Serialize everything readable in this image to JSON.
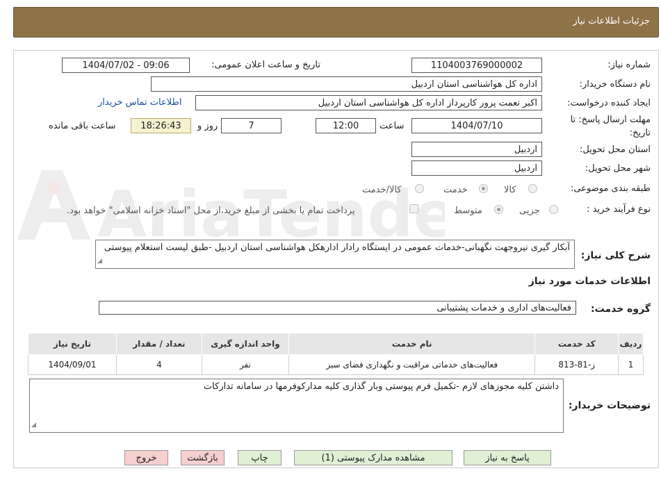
{
  "header": {
    "title": "جزئیات اطلاعات نیاز"
  },
  "watermark": {
    "text": "AriaTender.neT"
  },
  "fields": {
    "need_number_label": "شماره نیاز:",
    "need_number": "1104003769000002",
    "announce_label": "تاریخ و ساعت اعلان عمومی:",
    "announce_value": "1404/07/02 - 09:06",
    "buyer_org_label": "نام دستگاه خریدار:",
    "buyer_org": "اداره کل هواشناسی استان اردبیل",
    "requester_label": "ایجاد کننده درخواست:",
    "requester": "اکبر نعمت پرور کارپرداز اداره کل هواشناسی استان اردبیل",
    "contact_link": "اطلاعات تماس خریدار",
    "deadline_label_1": "مهلت ارسال پاسخ: تا",
    "deadline_label_2": "تاریخ:",
    "deadline_date": "1404/07/10",
    "time_label": "ساعت",
    "deadline_time": "12:00",
    "days_value": "7",
    "days_label": "روز و",
    "remaining_time": "18:26:43",
    "remaining_label": "ساعت باقی مانده",
    "province_label": "استان محل تحویل:",
    "province": "اردبیل",
    "city_label": "شهر محل تحویل:",
    "city": "اردبیل",
    "category_label": "طبقه بندی موضوعی:",
    "category_options": [
      "کالا",
      "خدمت",
      "کالا/خدمت"
    ],
    "category_selected": "خدمت",
    "process_label": "نوع فرآیند خرید :",
    "process_options": [
      "جزیی",
      "متوسط"
    ],
    "process_selected": "متوسط",
    "payment_note": "پرداخت تمام یا بخشی از مبلغ خرید،از محل \"اسناد خزانه اسلامی\" خواهد بود.",
    "description_label": "شرح کلی نیاز:",
    "description": "آبکار گیری نیروجهت نگهبانی-خدمات عمومی در ایستگاه رادار ادارهکل هواشناسی استان اردبیل -طبق لیست استعلام پیوستی"
  },
  "services": {
    "section_title": "اطلاعات خدمات مورد نیاز",
    "group_label": "گروه خدمت:",
    "group_value": "فعالیت‌های اداری و خدمات پشتیبانی",
    "columns": [
      "ردیف",
      "کد خدمت",
      "نام خدمت",
      "واحد اندازه گیری",
      "تعداد / مقدار",
      "تاریخ نیاز"
    ],
    "rows": [
      [
        "1",
        "ز-81-813",
        "فعالیت‌های خدماتی مراقبت و نگهداری فضای سبز",
        "نفر",
        "4",
        "1404/09/01"
      ]
    ]
  },
  "buyer_notes": {
    "label": "توضیحات خریدار:",
    "text": "داشتن کلیه مجوزهای لازم -تکمیل فرم پیوستی  وبار گذاری کلیه مدارکوفرمها در سامانه تدارکات"
  },
  "buttons": {
    "reply": "پاسخ به نیاز",
    "attachments": "مشاهده مدارک پیوستی (1)",
    "print": "چاپ",
    "back": "بازگشت",
    "exit": "خروج"
  }
}
